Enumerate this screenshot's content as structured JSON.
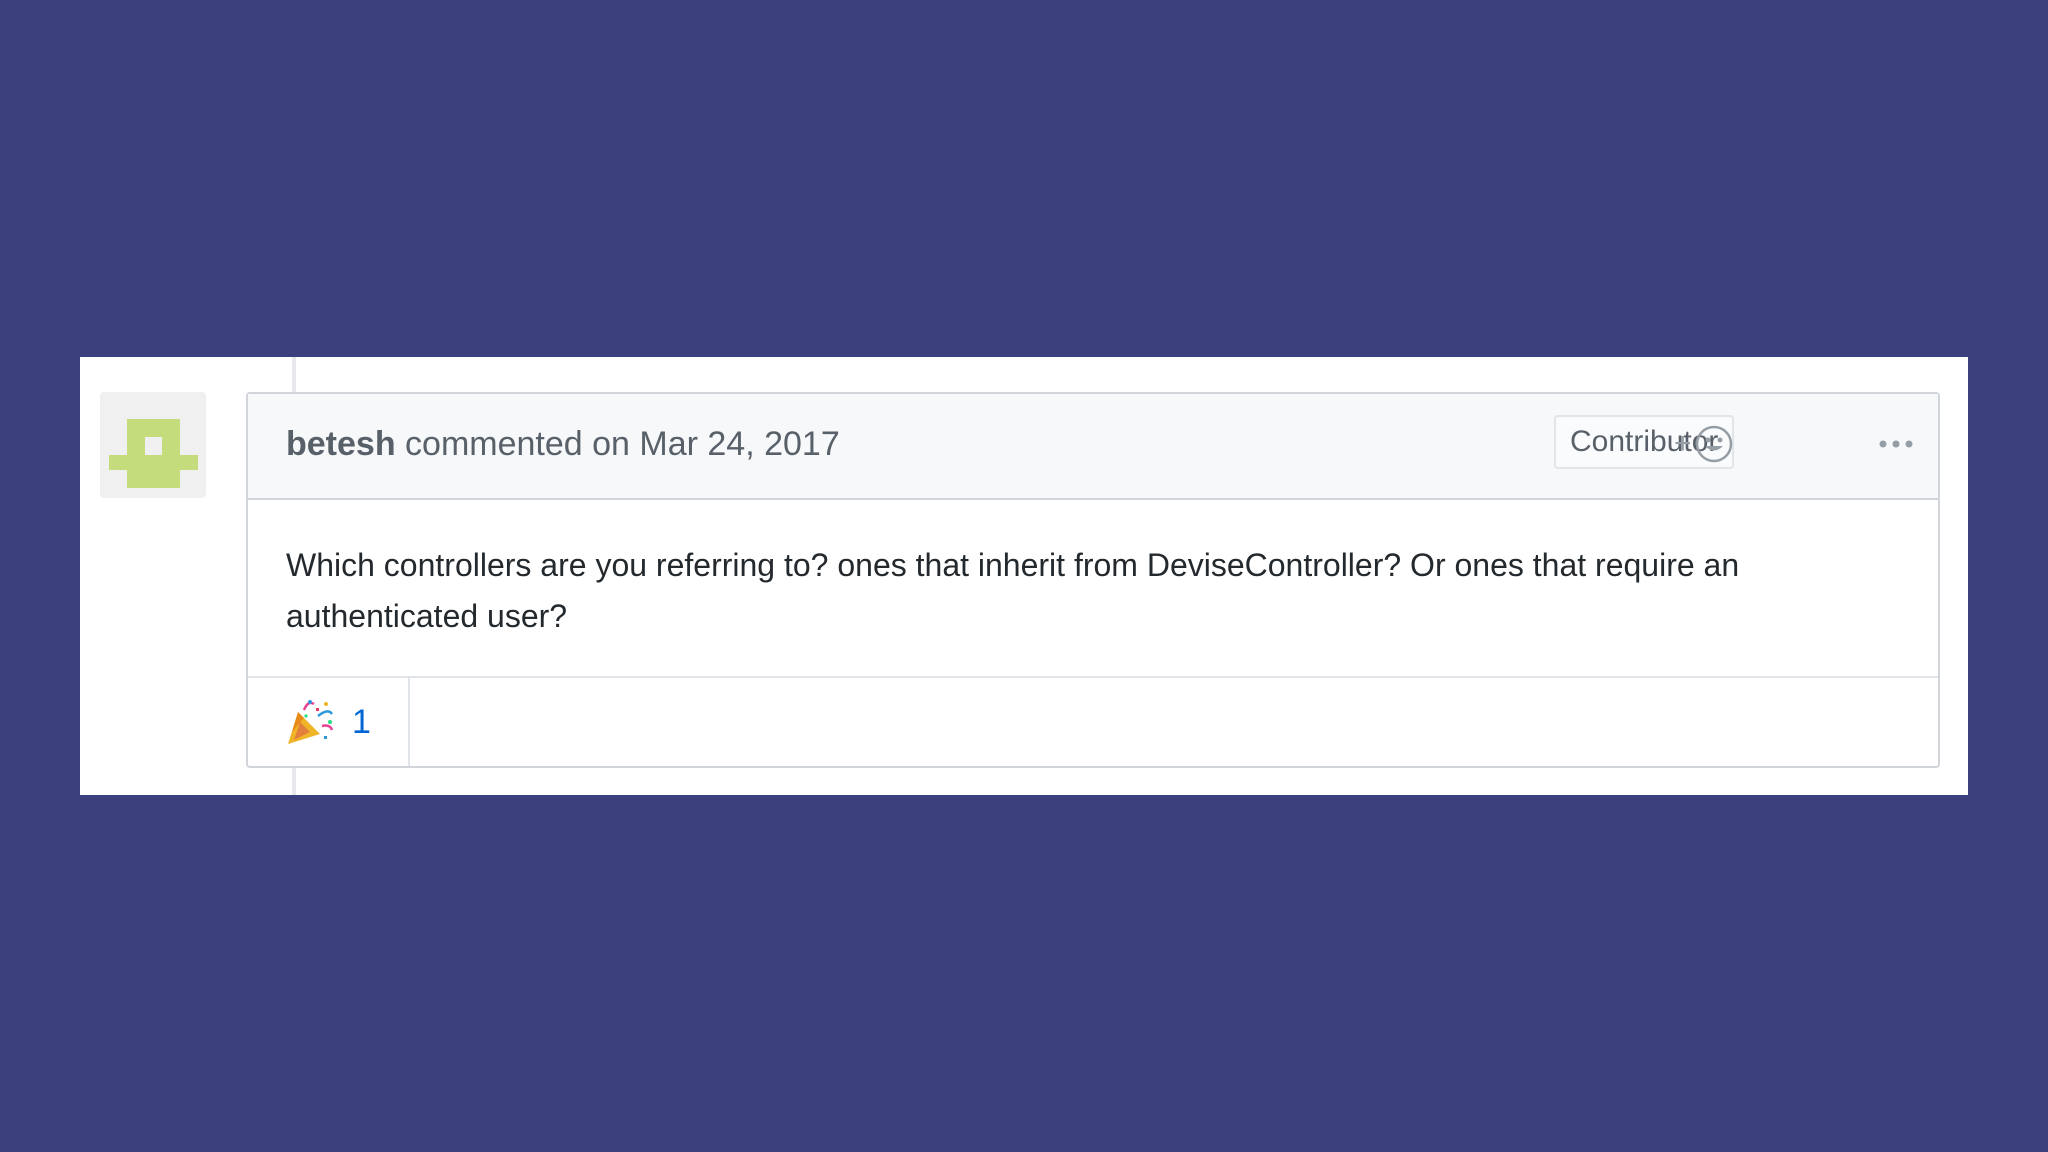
{
  "comment": {
    "author": "betesh",
    "meta": "commented on Mar 24, 2017",
    "badge": "Contributor",
    "body": "Which controllers are you referring to? ones that inherit from DeviseController? Or ones that require an authenticated user?",
    "add_reaction_plus": "+",
    "reactions": [
      {
        "emoji": "party-popper",
        "count": "1"
      }
    ]
  },
  "icons": {
    "avatar": "identicon-avatar",
    "reaction_picker": "smiley-icon",
    "more": "kebab-horizontal-icon"
  },
  "colors": {
    "background": "#3b3f7b",
    "avatar_green": "#c5dc7c",
    "link_blue": "#0366d6"
  }
}
